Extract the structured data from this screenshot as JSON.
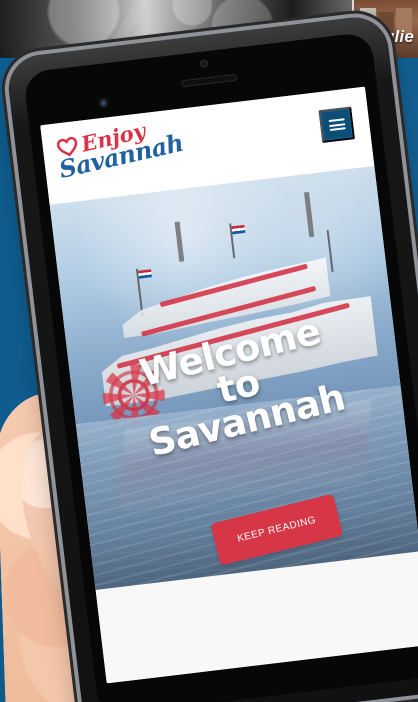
{
  "banner": {
    "person_label": "Julie"
  },
  "site": {
    "logo_top": "Enjoy",
    "logo_bottom": "Savannah",
    "menu_icon": "hamburger-icon"
  },
  "hero": {
    "headline_line1": "Welcome",
    "headline_line2": "to",
    "headline_line3": "Savannah",
    "button_label": "KEEP READING"
  },
  "colors": {
    "page_bg": "#0f5f93",
    "menu_bg": "#0d4e79",
    "button_bg": "#d63645",
    "logo_red": "#da3345",
    "logo_blue": "#1f61a1"
  }
}
